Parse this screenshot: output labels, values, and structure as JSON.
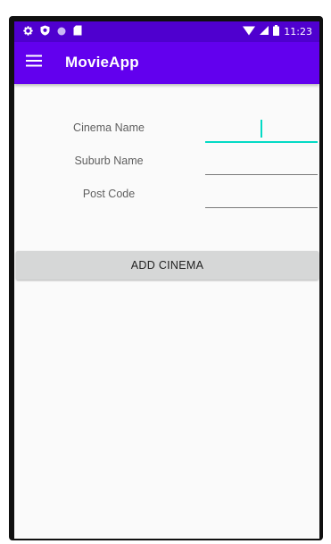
{
  "status_bar": {
    "time": "11:23",
    "left_icons": [
      "gear-icon",
      "shield-icon",
      "circle-icon",
      "sd-card-icon"
    ],
    "right_icons": [
      "wifi-icon",
      "signal-icon",
      "battery-icon"
    ]
  },
  "app_bar": {
    "title": "MovieApp",
    "menu_icon": "hamburger-menu-icon"
  },
  "form": {
    "fields": [
      {
        "label": "Cinema Name",
        "value": "",
        "focused": true
      },
      {
        "label": "Suburb Name",
        "value": "",
        "focused": false
      },
      {
        "label": "Post Code",
        "value": "",
        "focused": false
      }
    ]
  },
  "actions": {
    "add_label": "ADD CINEMA"
  },
  "colors": {
    "status_bar": "#4f00cf",
    "app_bar": "#6200ee",
    "accent": "#03dac5",
    "background": "#fafafa",
    "button": "#d6d7d7"
  }
}
